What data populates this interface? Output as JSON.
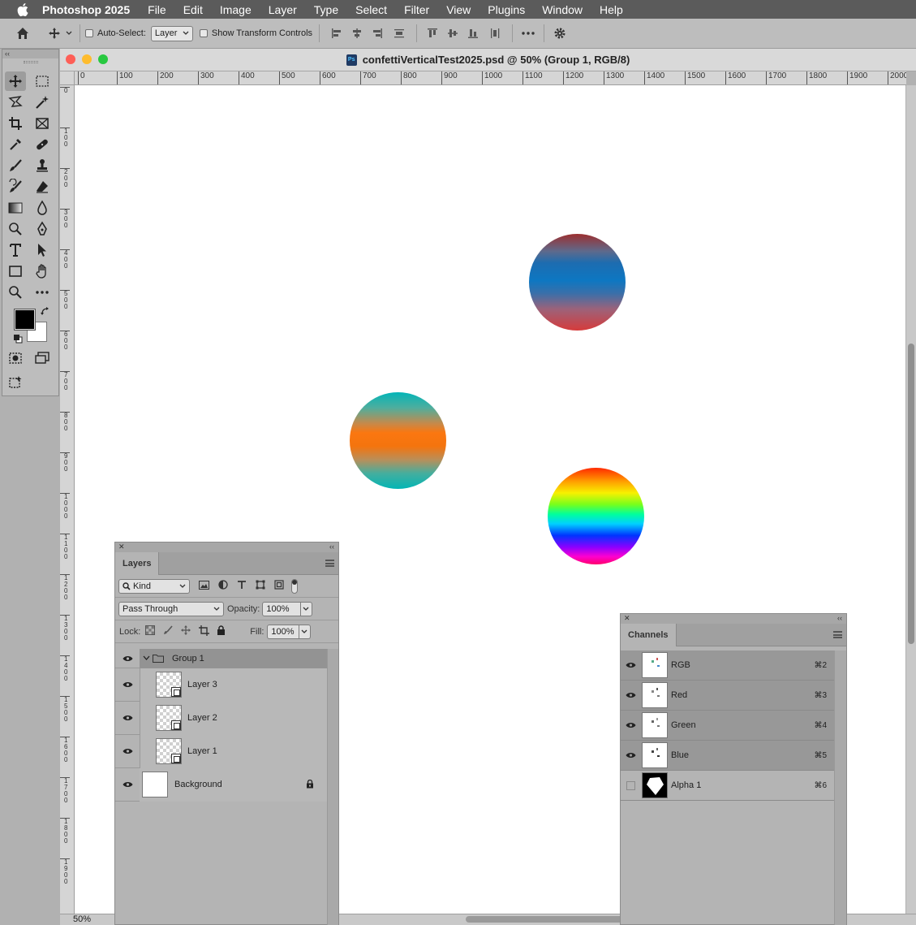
{
  "menubar": {
    "app_name": "Photoshop 2025",
    "items": [
      "File",
      "Edit",
      "Image",
      "Layer",
      "Type",
      "Select",
      "Filter",
      "View",
      "Plugins",
      "Window",
      "Help"
    ]
  },
  "options_bar": {
    "auto_select_label": "Auto-Select:",
    "auto_select_value": "Layer",
    "show_transform_label": "Show Transform Controls"
  },
  "document": {
    "title": "confettiVerticalTest2025.psd @ 50% (Group 1, RGB/8)",
    "zoom": "50%",
    "ruler_h": [
      "0",
      "100",
      "200",
      "300",
      "400",
      "500",
      "600",
      "700",
      "800",
      "900",
      "1000",
      "1100",
      "1200",
      "1300",
      "1400",
      "1500",
      "1600",
      "1700",
      "1800",
      "1900",
      "2000"
    ],
    "ruler_v": [
      "0",
      "100",
      "200",
      "300",
      "400",
      "500",
      "600",
      "700",
      "800",
      "900",
      "1000",
      "1100",
      "1200",
      "1300",
      "1400",
      "1500",
      "1600",
      "1700",
      "1800",
      "1900"
    ]
  },
  "layers_panel": {
    "tab": "Layers",
    "filter_kind": "Kind",
    "blend_mode": "Pass Through",
    "opacity_label": "Opacity:",
    "opacity_value": "100%",
    "lock_label": "Lock:",
    "fill_label": "Fill:",
    "fill_value": "100%",
    "group_name": "Group 1",
    "layers": [
      {
        "name": "Layer 3"
      },
      {
        "name": "Layer 2"
      },
      {
        "name": "Layer 1"
      }
    ],
    "background_name": "Background"
  },
  "channels_panel": {
    "tab": "Channels",
    "channels": [
      {
        "name": "RGB",
        "shortcut": "⌘2",
        "visible": true
      },
      {
        "name": "Red",
        "shortcut": "⌘3",
        "visible": true
      },
      {
        "name": "Green",
        "shortcut": "⌘4",
        "visible": true
      },
      {
        "name": "Blue",
        "shortcut": "⌘5",
        "visible": true
      },
      {
        "name": "Alpha 1",
        "shortcut": "⌘6",
        "visible": false
      }
    ]
  },
  "colors": {
    "foreground": "#000000",
    "background": "#ffffff",
    "close": "#fe5f57",
    "minimize": "#febc2e",
    "zoom": "#28c840"
  }
}
